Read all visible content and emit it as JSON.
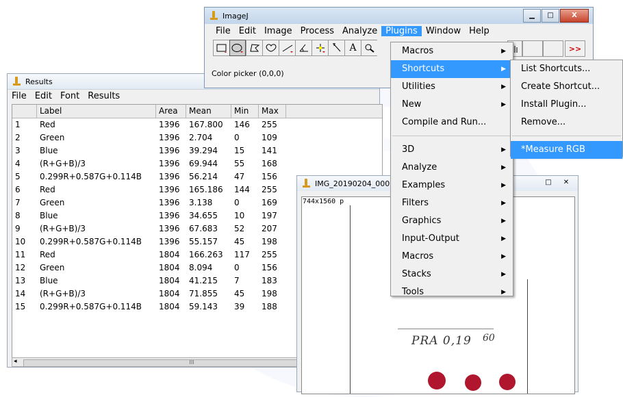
{
  "results_window": {
    "title": "Results",
    "menu": [
      "File",
      "Edit",
      "Font",
      "Results"
    ],
    "columns": [
      "",
      "Label",
      "Area",
      "Mean",
      "Min",
      "Max"
    ],
    "rows": [
      [
        "1",
        "Red",
        "1396",
        "167.800",
        "146",
        "255"
      ],
      [
        "2",
        "Green",
        "1396",
        "2.704",
        "0",
        "109"
      ],
      [
        "3",
        "Blue",
        "1396",
        "39.294",
        "15",
        "141"
      ],
      [
        "4",
        "(R+G+B)/3",
        "1396",
        "69.944",
        "55",
        "168"
      ],
      [
        "5",
        "0.299R+0.587G+0.114B",
        "1396",
        "56.214",
        "47",
        "156"
      ],
      [
        "6",
        "Red",
        "1396",
        "165.186",
        "144",
        "255"
      ],
      [
        "7",
        "Green",
        "1396",
        "3.138",
        "0",
        "169"
      ],
      [
        "8",
        "Blue",
        "1396",
        "34.655",
        "10",
        "197"
      ],
      [
        "9",
        "(R+G+B)/3",
        "1396",
        "67.683",
        "52",
        "207"
      ],
      [
        "10",
        "0.299R+0.587G+0.114B",
        "1396",
        "55.157",
        "45",
        "198"
      ],
      [
        "11",
        "Red",
        "1804",
        "166.263",
        "117",
        "255"
      ],
      [
        "12",
        "Green",
        "1804",
        "8.094",
        "0",
        "156"
      ],
      [
        "13",
        "Blue",
        "1804",
        "41.215",
        "7",
        "183"
      ],
      [
        "14",
        "(R+G+B)/3",
        "1804",
        "71.855",
        "45",
        "198"
      ],
      [
        "15",
        "0.299R+0.587G+0.114B",
        "1804",
        "59.143",
        "39",
        "188"
      ]
    ],
    "scroll_thumb": "III"
  },
  "imagej_window": {
    "title": "ImageJ",
    "menu": [
      "File",
      "Edit",
      "Image",
      "Process",
      "Analyze",
      "Plugins",
      "Window",
      "Help"
    ],
    "active_menu": "Plugins",
    "status": "Color picker (0,0,0)",
    "more_tools": ">>",
    "buttons": {
      "minimize": "▁",
      "maximize": "□",
      "close": "X"
    }
  },
  "image_window": {
    "title": "IMG_20190204_000",
    "info": "744x1560 p",
    "handwriting": "PRA 0,19",
    "handwriting2": "60",
    "buttons": {
      "maximize": "□",
      "close": "✕"
    }
  },
  "plugins_menu": {
    "items": [
      {
        "label": "Macros",
        "submenu": true
      },
      {
        "label": "Shortcuts",
        "submenu": true,
        "highlighted": true
      },
      {
        "label": "Utilities",
        "submenu": true
      },
      {
        "label": "New",
        "submenu": true
      },
      {
        "label": "Compile and Run...",
        "submenu": false
      }
    ],
    "items2": [
      {
        "label": "3D",
        "submenu": true
      },
      {
        "label": "Analyze",
        "submenu": true
      },
      {
        "label": "Examples",
        "submenu": true
      },
      {
        "label": "Filters",
        "submenu": true
      },
      {
        "label": "Graphics",
        "submenu": true
      },
      {
        "label": "Input-Output",
        "submenu": true
      },
      {
        "label": "Macros",
        "submenu": true
      },
      {
        "label": "Stacks",
        "submenu": true
      },
      {
        "label": "Tools",
        "submenu": true
      }
    ]
  },
  "shortcuts_menu": {
    "items": [
      "List Shortcuts...",
      "Create Shortcut...",
      "Install Plugin...",
      "Remove..."
    ],
    "items2": [
      "*Measure RGB"
    ]
  },
  "colors": {
    "highlight": "#3399ff",
    "dot": "#b0162d"
  },
  "icons": [
    "imagej-logo-icon",
    "rectangle-tool-icon",
    "oval-tool-icon",
    "polygon-tool-icon",
    "freehand-tool-icon",
    "line-tool-icon",
    "angle-tool-icon",
    "point-tool-icon",
    "wand-tool-icon",
    "text-tool-icon",
    "magnifier-tool-icon",
    "submenu-arrow-icon"
  ]
}
